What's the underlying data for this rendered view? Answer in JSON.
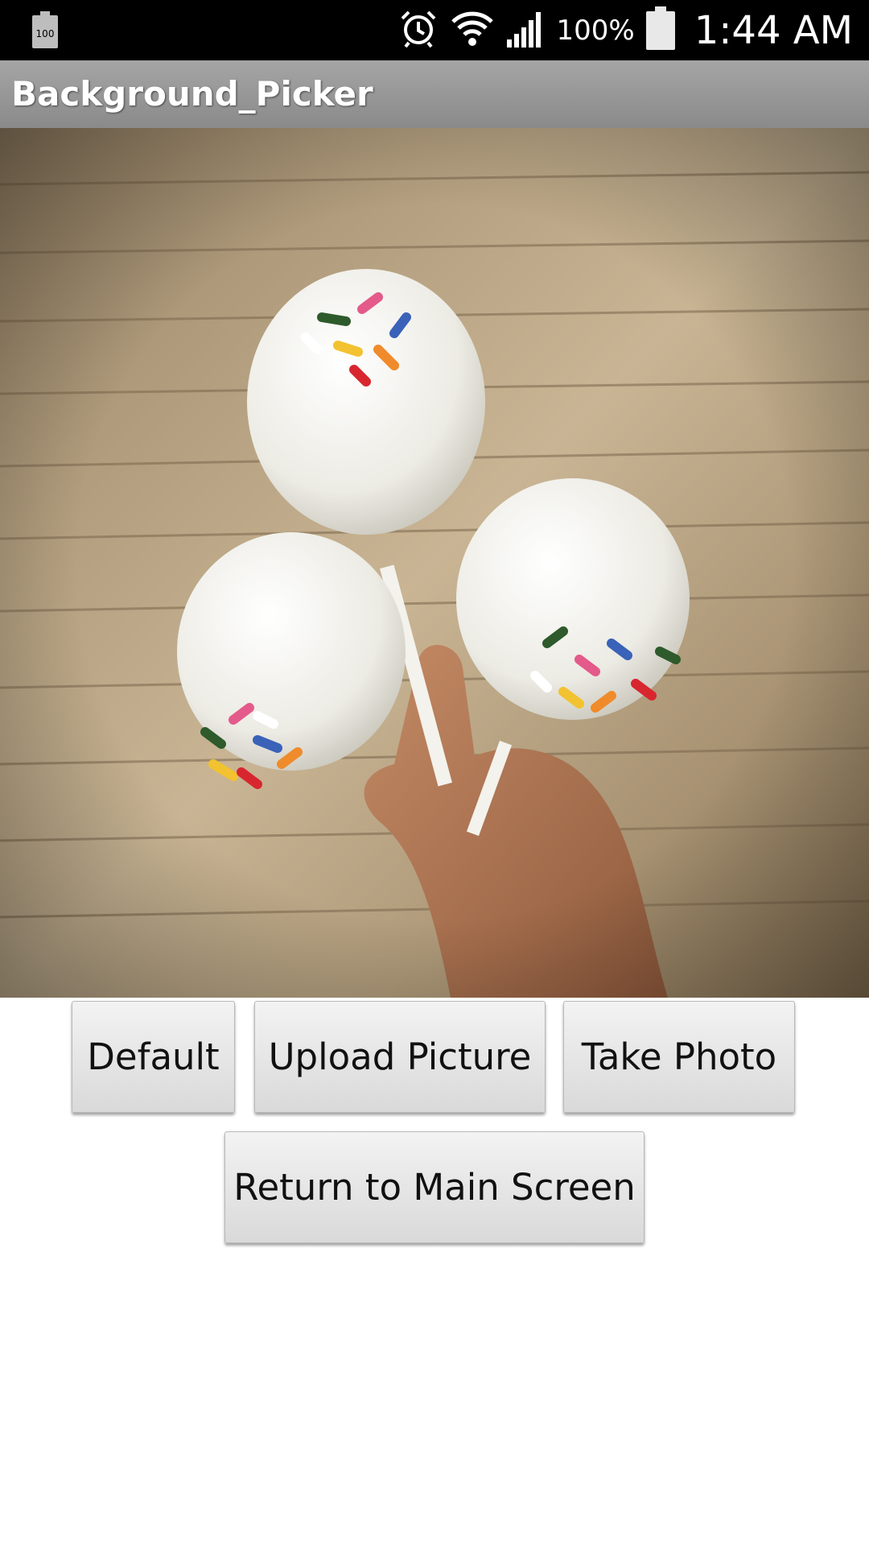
{
  "status_bar": {
    "battery_left_text": "100",
    "battery_percent": "100%",
    "time": "1:44 AM",
    "icons": [
      "battery-icon",
      "alarm-icon",
      "wifi-icon",
      "signal-icon",
      "battery-icon"
    ]
  },
  "action_bar": {
    "title": "Background_Picker"
  },
  "photo": {
    "subject": "cake-pops-image"
  },
  "buttons": {
    "default": "Default",
    "upload": "Upload Picture",
    "take_photo": "Take Photo",
    "return_main": "Return to Main Screen"
  },
  "colors": {
    "status_bar_bg": "#000000",
    "action_bar_bg": "#9a9a9a",
    "button_bg": "#e6e6e6"
  }
}
